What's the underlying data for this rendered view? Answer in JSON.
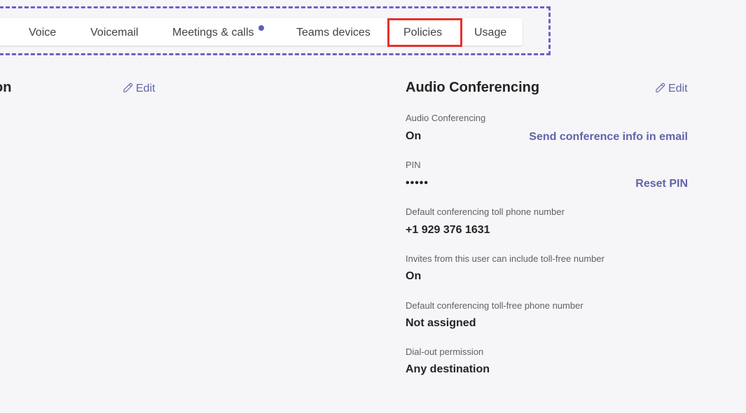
{
  "tabs": [
    {
      "label": "Voice"
    },
    {
      "label": "Voicemail"
    },
    {
      "label": "Meetings & calls",
      "has_notification_dot": true
    },
    {
      "label": "Teams devices"
    },
    {
      "label": "Policies",
      "highlighted": true
    },
    {
      "label": "Usage"
    }
  ],
  "left_panel": {
    "heading_fragment": "on",
    "edit_label": "Edit"
  },
  "audio_conferencing": {
    "title": "Audio Conferencing",
    "edit_label": "Edit",
    "fields": [
      {
        "label": "Audio Conferencing",
        "value": "On",
        "action": "Send conference info in email"
      },
      {
        "label": "PIN",
        "value": "•••••",
        "action": "Reset PIN"
      },
      {
        "label": "Default conferencing toll phone number",
        "value": "+1 929 376 1631"
      },
      {
        "label": "Invites from this user can include toll-free number",
        "value": "On"
      },
      {
        "label": "Default conferencing toll-free phone number",
        "value": "Not assigned"
      },
      {
        "label": "Dial-out permission",
        "value": "Any destination"
      }
    ]
  },
  "colors": {
    "accent": "#6264a7",
    "highlight_box": "#e8302c",
    "dashed_outline": "#6b63c4",
    "notification_dot": "#5b5fc7"
  }
}
